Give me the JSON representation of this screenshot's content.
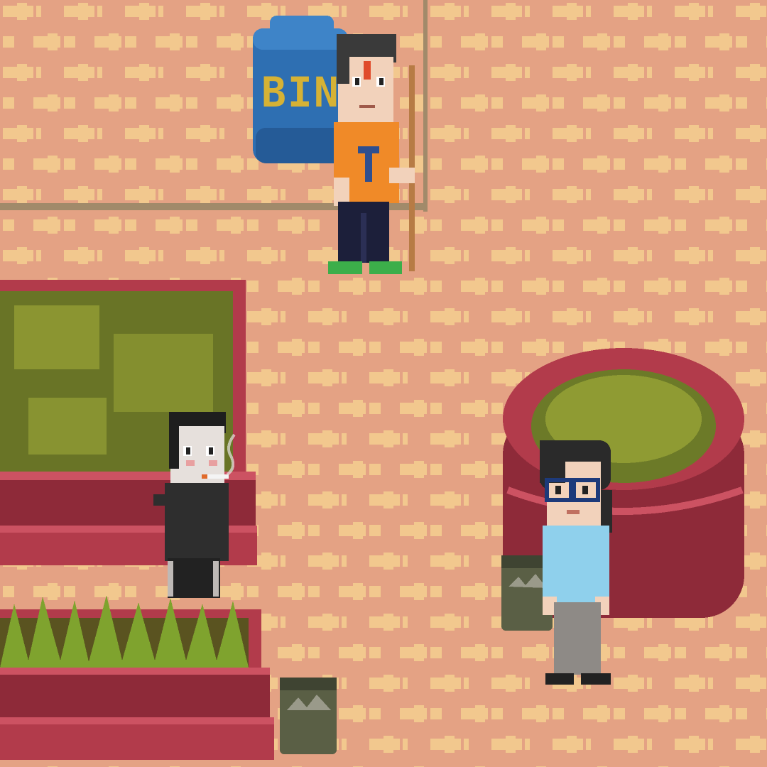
{
  "scene": {
    "colors": {
      "floor_base": "#e4a284",
      "floor_paver": "#f2c88e",
      "floor_edge": "#c98a6d",
      "border_line": "#a18a6a",
      "planter_red": "#b23b4b",
      "planter_dark": "#8e2a39",
      "planter_light": "#cc5262",
      "soil": "#5a5320",
      "foliage_dark": "#6c7a28",
      "foliage_light": "#a7b13b",
      "grass": "#7fa32e",
      "bin_blue": "#2e6fb2",
      "bin_dark": "#1f4e86",
      "bin_text": "#d6b235",
      "bucket_green": "#5a5f45",
      "bucket_dark": "#3f4432"
    },
    "bin": {
      "label": "BIN"
    },
    "characters": [
      {
        "id": "sweeper",
        "shirt": "#f08a28",
        "pants": "#1c1f3a",
        "shoes": "#3cae4a",
        "hair": "#3a3a3a"
      },
      {
        "id": "smoker",
        "shirt": "#2e2e2e",
        "pants": "#222222",
        "hair": "#1e1e1e"
      },
      {
        "id": "glasses-girl",
        "shirt": "#8fd0ec",
        "pants": "#8e8a86",
        "hair": "#2a2a2a",
        "glasses": "#1d3a7a"
      }
    ]
  }
}
